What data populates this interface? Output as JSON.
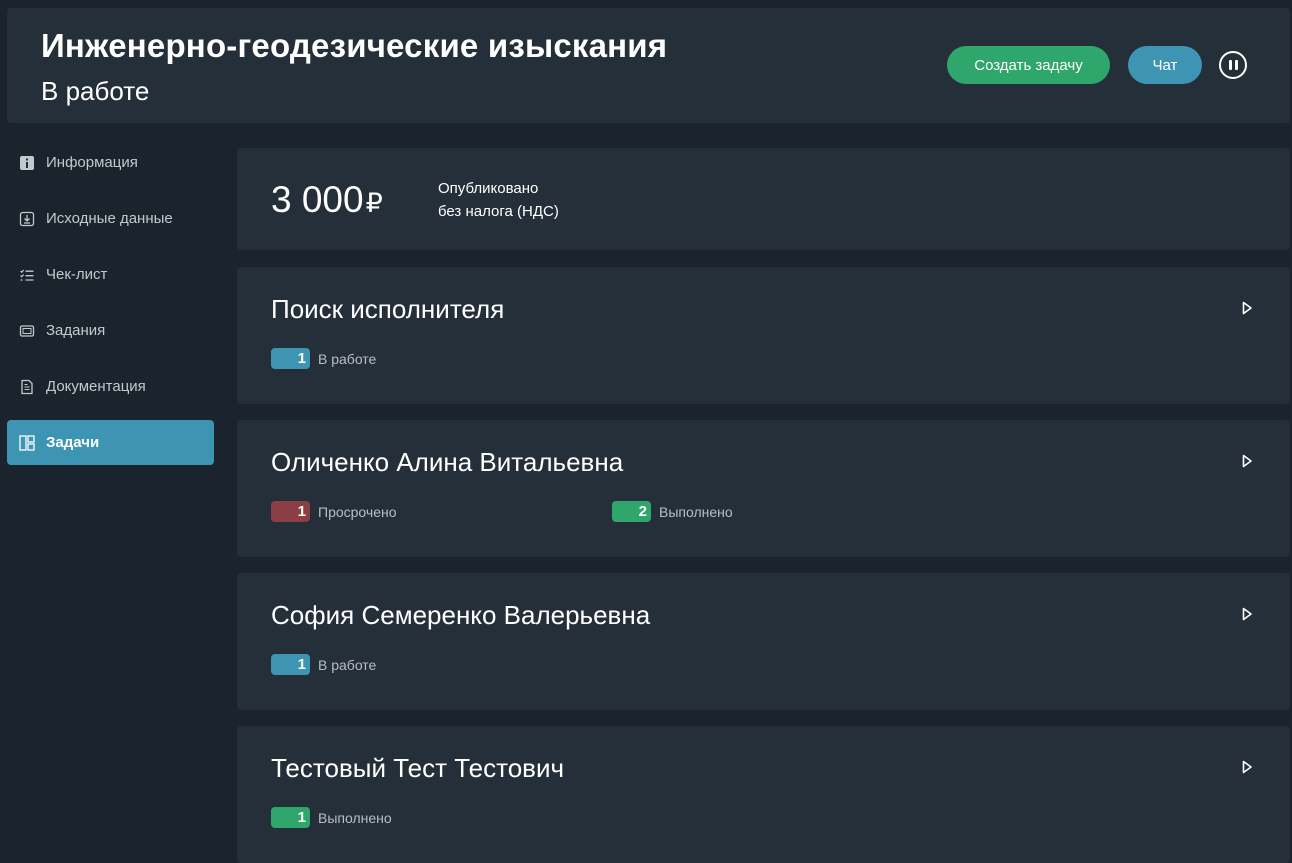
{
  "header": {
    "title": "Инженерно-геодезические изыскания",
    "status": "В работе",
    "create_task_label": "Создать задачу",
    "chat_label": "Чат",
    "pause_icon": "pause-icon"
  },
  "sidebar": {
    "items": [
      {
        "label": "Информация",
        "icon": "info-icon",
        "active": false
      },
      {
        "label": "Исходные данные",
        "icon": "download-icon",
        "active": false
      },
      {
        "label": "Чек-лист",
        "icon": "checklist-icon",
        "active": false
      },
      {
        "label": "Задания",
        "icon": "cards-icon",
        "active": false
      },
      {
        "label": "Документация",
        "icon": "document-icon",
        "active": false
      },
      {
        "label": "Задачи",
        "icon": "board-icon",
        "active": true
      }
    ]
  },
  "price": {
    "amount": "3 000",
    "currency": "₽",
    "status": "Опубликовано",
    "tax_note": "без налога (НДС)"
  },
  "colors": {
    "accent_blue": "#3d94b3",
    "success_green": "#2fa66b",
    "overdue_red": "#8b3e44",
    "card_bg": "#252f39",
    "page_bg": "#1b242c"
  },
  "tasks": [
    {
      "title": "Поиск исполнителя",
      "badges": [
        {
          "count": "1",
          "label": "В работе",
          "color": "blue"
        }
      ]
    },
    {
      "title": "Оличенко Алина Витальевна",
      "badges": [
        {
          "count": "1",
          "label": "Просрочено",
          "color": "red"
        },
        {
          "count": "2",
          "label": "Выполнено",
          "color": "green"
        }
      ]
    },
    {
      "title": "София Семеренко Валерьевна",
      "badges": [
        {
          "count": "1",
          "label": "В работе",
          "color": "blue"
        }
      ]
    },
    {
      "title": "Тестовый Тест Тестович",
      "badges": [
        {
          "count": "1",
          "label": "Выполнено",
          "color": "green"
        }
      ]
    }
  ]
}
